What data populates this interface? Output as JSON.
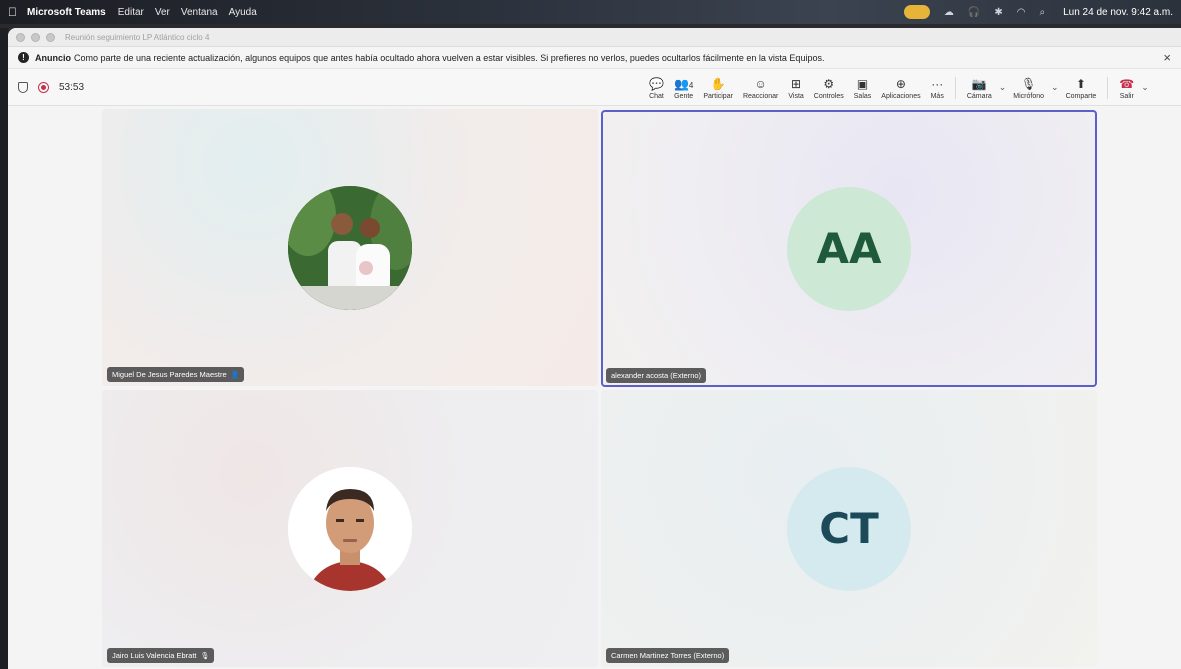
{
  "menubar": {
    "app": "Microsoft Teams",
    "items": [
      "Editar",
      "Ver",
      "Ventana",
      "Ayuda"
    ],
    "clock": "Lun 24 de nov.  9:42 a.m."
  },
  "window": {
    "title": "Reunión seguimiento LP Atlántico ciclo 4"
  },
  "banner": {
    "bold": "Anuncio",
    "text": "Como parte de una reciente actualización, algunos equipos que antes había ocultado ahora vuelven a estar visibles. Si prefieres no verlos, puedes ocultarlos fácilmente en la vista Equipos."
  },
  "meeting": {
    "timer": "53:53",
    "people_count": "4"
  },
  "toolbar": {
    "chat": "Chat",
    "people": "Gente",
    "raise": "Participar",
    "react": "Reaccionar",
    "view": "Vista",
    "controls": "Controles",
    "rooms": "Salas",
    "apps": "Aplicaciones",
    "more": "Más",
    "camera": "Cámara",
    "mic": "Micrófono",
    "share": "Comparte",
    "leave": "Salir"
  },
  "participants": [
    {
      "name": "Miguel De Jesus Paredes Maestre",
      "initials": ""
    },
    {
      "name": "alexander acosta (Externo)",
      "initials": "AA"
    },
    {
      "name": "Jairo Luis Valencia Ebratt",
      "initials": ""
    },
    {
      "name": "Carmen Martinez Torres (Externo)",
      "initials": "CT"
    }
  ]
}
